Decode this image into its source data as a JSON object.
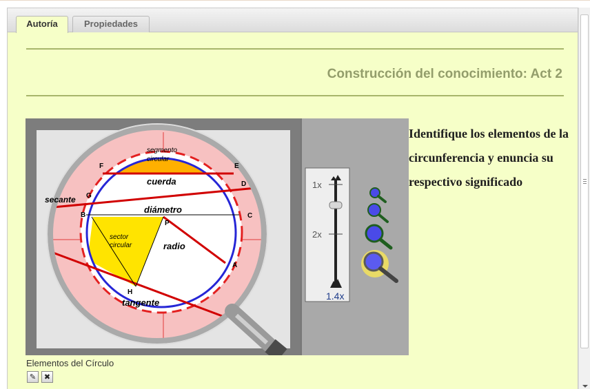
{
  "tabs": [
    {
      "label": "Autoría",
      "active": true
    },
    {
      "label": "Propiedades",
      "active": false
    }
  ],
  "section_title": "Construcción del conocimiento: Act 2",
  "prompt_text": "Identifique los elementos de la circunferencia y enuncia su respectivo significado",
  "figure": {
    "caption": "Elementos del Círculo",
    "diagram_labels": {
      "segment": "segmento circular",
      "chord": "cuerda",
      "diameter": "diámetro",
      "secant": "secante",
      "sector": "sector circular",
      "radius": "radio",
      "tangent": "tangente",
      "points": [
        "F",
        "E",
        "G",
        "D",
        "B",
        "P",
        "C",
        "A",
        "H"
      ]
    },
    "zoom": {
      "level_1": "1x",
      "level_2": "2x",
      "current": "1.4x",
      "current_fraction": 0.4
    }
  },
  "actions": {
    "edit_icon": "edit-pencil-icon",
    "delete_icon": "delete-x-icon"
  },
  "colors": {
    "panel_bg": "#f6ffc8",
    "title": "#939d6b",
    "rule": "#a7b56a"
  }
}
